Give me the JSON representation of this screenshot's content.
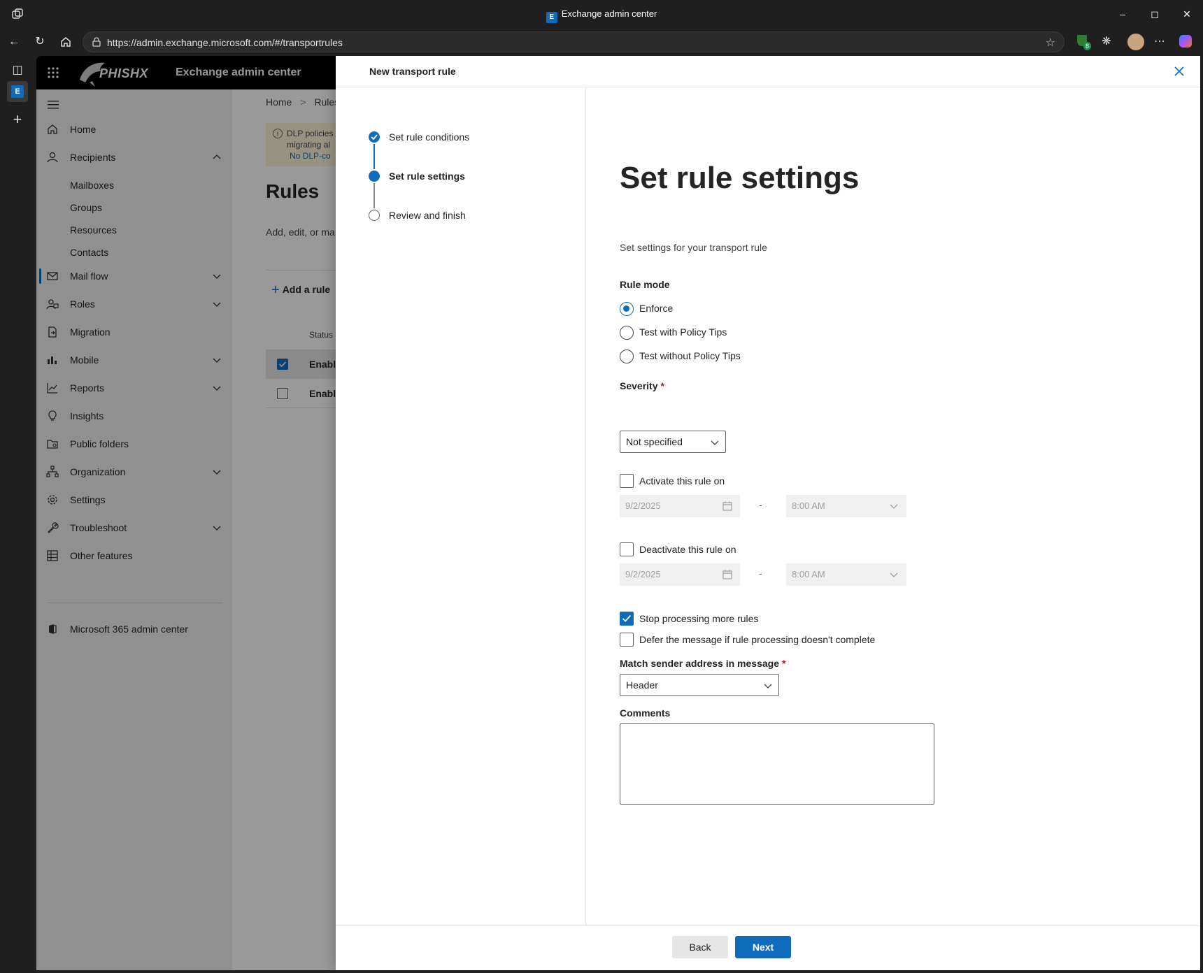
{
  "window": {
    "title": "Exchange admin center",
    "url": "https://admin.exchange.microsoft.com/#/transportrules",
    "extension_badge": "8"
  },
  "app": {
    "logo_text": "PHISHX",
    "name": "Exchange admin center"
  },
  "nav": {
    "items": [
      {
        "label": "Home"
      },
      {
        "label": "Recipients"
      },
      {
        "label": "Mail flow"
      },
      {
        "label": "Roles"
      },
      {
        "label": "Migration"
      },
      {
        "label": "Mobile"
      },
      {
        "label": "Reports"
      },
      {
        "label": "Insights"
      },
      {
        "label": "Public folders"
      },
      {
        "label": "Organization"
      },
      {
        "label": "Settings"
      },
      {
        "label": "Troubleshoot"
      },
      {
        "label": "Other features"
      }
    ],
    "recipients_sub": [
      "Mailboxes",
      "Groups",
      "Resources",
      "Contacts"
    ],
    "m365": "Microsoft 365 admin center"
  },
  "main": {
    "breadcrumb_home": "Home",
    "breadcrumb_sep": ">",
    "breadcrumb_rules": "Rules",
    "warn_line1": "DLP policies",
    "warn_line2": "migrating al",
    "warn_link": "No DLP-co",
    "title": "Rules",
    "desc": "Add, edit, or ma",
    "add_rule": "Add a rule",
    "col_status": "Status",
    "rows": [
      {
        "status": "Enable",
        "checked": true
      },
      {
        "status": "Enable",
        "checked": false
      }
    ]
  },
  "panel": {
    "title": "New transport rule",
    "steps": [
      {
        "label": "Set rule conditions",
        "state": "done"
      },
      {
        "label": "Set rule settings",
        "state": "current"
      },
      {
        "label": "Review and finish",
        "state": "todo"
      }
    ],
    "heading": "Set rule settings",
    "subheading": "Set settings for your transport rule",
    "rule_mode_label": "Rule mode",
    "rule_modes": [
      {
        "label": "Enforce",
        "checked": true
      },
      {
        "label": "Test with Policy Tips",
        "checked": false
      },
      {
        "label": "Test without Policy Tips",
        "checked": false
      }
    ],
    "severity_label": "Severity",
    "required_mark": "*",
    "severity_value": "Not specified",
    "activate_label": "Activate this rule on",
    "activate_date": "9/2/2025",
    "activate_time": "8:00 AM",
    "deactivate_label": "Deactivate this rule on",
    "deactivate_date": "9/2/2025",
    "deactivate_time": "8:00 AM",
    "range_dash": "-",
    "stop_processing_label": "Stop processing more rules",
    "stop_processing_checked": true,
    "defer_label": "Defer the message if rule processing doesn't complete",
    "defer_checked": false,
    "match_sender_label": "Match sender address in message",
    "match_sender_value": "Header",
    "comments_label": "Comments",
    "comments_value": "",
    "back_label": "Back",
    "next_label": "Next"
  },
  "colors": {
    "accent": "#0f6cbd",
    "header_bg": "#000000",
    "required": "#c50f1f"
  }
}
